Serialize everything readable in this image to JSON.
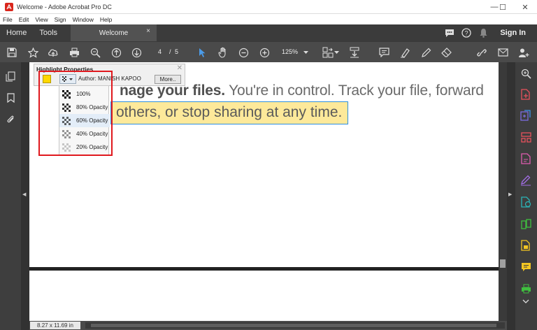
{
  "window": {
    "title": "Welcome - Adobe Acrobat Pro DC",
    "minimize": "—",
    "maximize": "☐",
    "close": "✕"
  },
  "menu": [
    "File",
    "Edit",
    "View",
    "Sign",
    "Window",
    "Help"
  ],
  "tabs": {
    "home": "Home",
    "tools": "Tools",
    "document": "Welcome",
    "close": "×"
  },
  "account": {
    "signin": "Sign In"
  },
  "toolbar": {
    "page_current": "4",
    "page_sep": "/",
    "page_total": "5",
    "zoom": "125%"
  },
  "document": {
    "line1_bold": "nage your files.",
    "line1_rest": " You're in control. Track your file, forward",
    "line2": "others, or stop sharing at any time."
  },
  "highlight_props": {
    "title": "Highlight Properties",
    "author": "Author: MANISH KAPOO",
    "more": "More..",
    "color": "#ffd800",
    "opacity_options": [
      "100%",
      "80% Opacity",
      "60% Opacity",
      "40% Opacity",
      "20% Opacity"
    ],
    "selected_index": 2
  },
  "status": {
    "page_size": "8.27 x 11.69 in"
  },
  "colors": {
    "accent_blue": "#2d8fe0",
    "annotation_red": "#e0191e",
    "highlight": "#fde99a"
  }
}
